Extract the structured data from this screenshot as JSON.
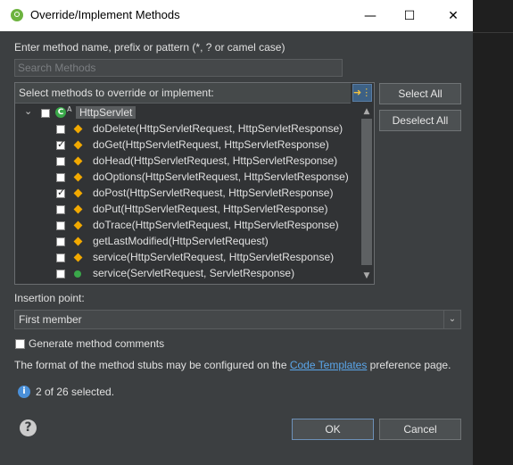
{
  "window": {
    "title": "Override/Implement Methods",
    "minimize_glyph": "—",
    "maximize_glyph": "☐",
    "close_glyph": "✕"
  },
  "filter": {
    "label": "Enter method name, prefix or pattern (*, ? or camel case)",
    "placeholder": "Search Methods"
  },
  "tree": {
    "header": "Select methods to override or implement:",
    "root": {
      "label": "HttpServlet",
      "checked": false,
      "expanded": true
    },
    "methods": [
      {
        "label": "doDelete(HttpServletRequest, HttpServletResponse)",
        "checked": false,
        "icon": "protected-method-icon"
      },
      {
        "label": "doGet(HttpServletRequest, HttpServletResponse)",
        "checked": true,
        "icon": "protected-method-icon"
      },
      {
        "label": "doHead(HttpServletRequest, HttpServletResponse)",
        "checked": false,
        "icon": "protected-method-icon"
      },
      {
        "label": "doOptions(HttpServletRequest, HttpServletResponse)",
        "checked": false,
        "icon": "protected-method-icon"
      },
      {
        "label": "doPost(HttpServletRequest, HttpServletResponse)",
        "checked": true,
        "icon": "protected-method-icon"
      },
      {
        "label": "doPut(HttpServletRequest, HttpServletResponse)",
        "checked": false,
        "icon": "protected-method-icon"
      },
      {
        "label": "doTrace(HttpServletRequest, HttpServletResponse)",
        "checked": false,
        "icon": "protected-method-icon"
      },
      {
        "label": "getLastModified(HttpServletRequest)",
        "checked": false,
        "icon": "protected-method-icon"
      },
      {
        "label": "service(HttpServletRequest, HttpServletResponse)",
        "checked": false,
        "icon": "protected-method-icon"
      },
      {
        "label": "service(ServletRequest, ServletResponse)",
        "checked": false,
        "icon": "public-method-icon"
      }
    ]
  },
  "buttons": {
    "select_all": "Select All",
    "deselect_all": "Deselect All",
    "ok": "OK",
    "cancel": "Cancel"
  },
  "insertion": {
    "label": "Insertion point:",
    "value": "First member"
  },
  "generate_comments": {
    "label": "Generate method comments",
    "checked": false
  },
  "format_note": {
    "before": "The format of the method stubs may be configured on the ",
    "link": "Code Templates",
    "after": " preference page."
  },
  "status": "2 of 26 selected.",
  "colors": {
    "dialog_bg": "#3c3f41",
    "accent": "#5aa6ea",
    "protected_icon": "#f2a900",
    "public_icon": "#3aa84a"
  }
}
